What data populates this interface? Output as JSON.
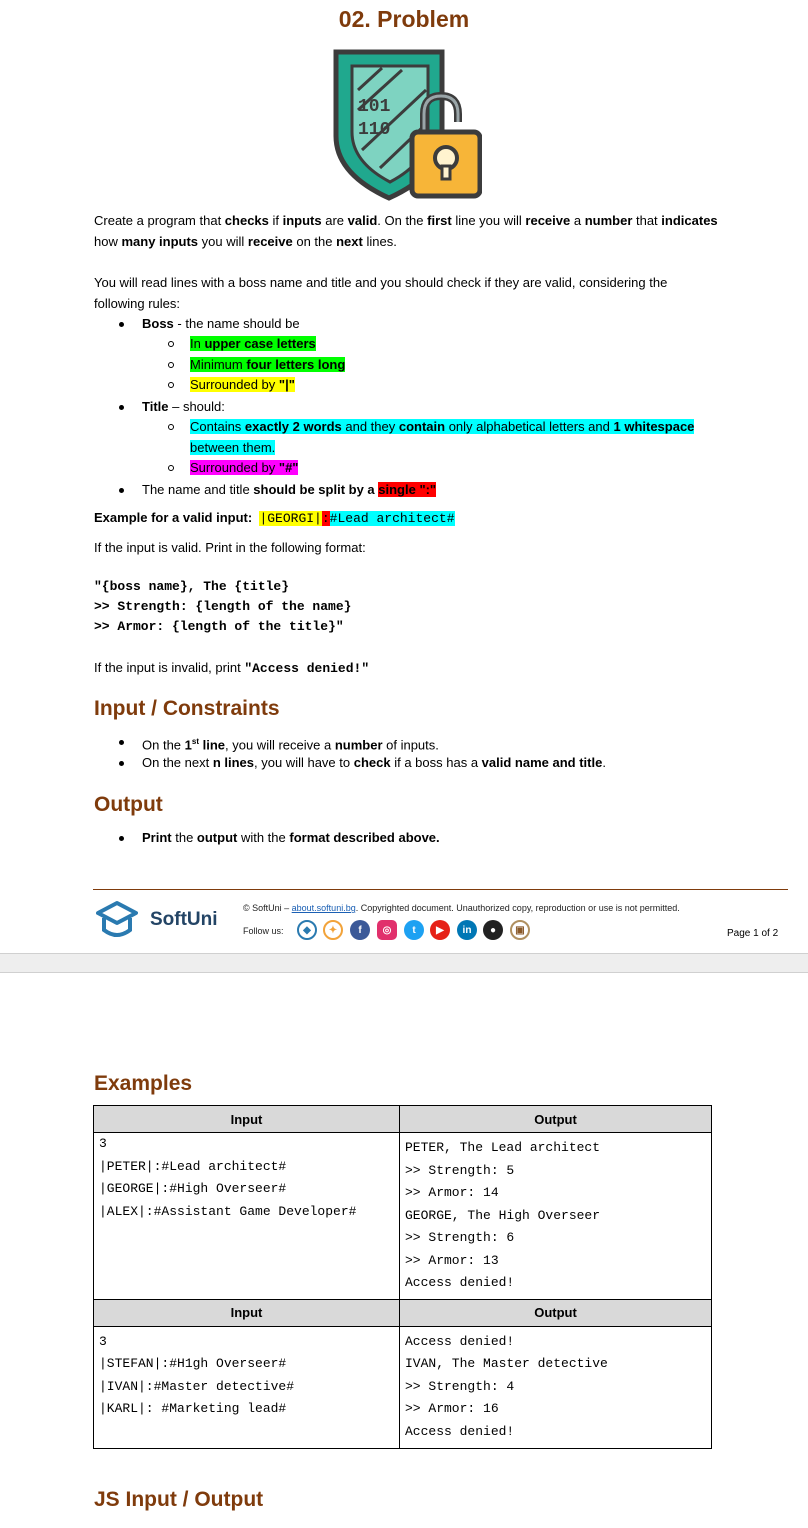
{
  "page1": {
    "title": "02. Problem",
    "intro": {
      "p1_a": "Create a program that ",
      "p1_b": "checks",
      "p1_c": " if ",
      "p1_d": "inputs",
      "p1_e": " are ",
      "p1_f": "valid",
      "p1_g": ". On the ",
      "p1_h": "first",
      "p1_i": " line you will ",
      "p1_j": "receive",
      "p1_k": " a ",
      "p1_l": "number",
      "p1_m": " that ",
      "p1_n": "indicates",
      "p1_o": " how ",
      "p1_p": "many inputs",
      "p1_q": " you will ",
      "p1_r": "receive",
      "p1_s": " on the ",
      "p1_t": "next",
      "p1_u": " lines.",
      "p2": "You will read lines with a boss name and title and you should check if they are valid, considering the following rules:"
    },
    "rules": {
      "boss_label": "Boss",
      "boss_text": " - the name should be",
      "boss_1a": "In ",
      "boss_1b": "upper case letters",
      "boss_2a": "Minimum ",
      "boss_2b": "four letters long",
      "boss_3a": "Surrounded by ",
      "boss_3b": "\"|\"",
      "title_label": "Title",
      "title_text": " – should:",
      "title_1a": "Contains ",
      "title_1b": "exactly 2 words",
      "title_1c": " and they ",
      "title_1d": "contain",
      "title_1e": " only alphabetical letters and ",
      "title_1f": "1 whitespace",
      "title_1g": "between them.",
      "title_2a": "Surrounded by ",
      "title_2b": "\"#\"",
      "split_a": "The name and title ",
      "split_b": "should be split by a ",
      "split_c": "single \":\""
    },
    "example": {
      "label": "Example for a valid input:",
      "part1": "|GEORGI|",
      "part2": ":",
      "part3": "#Lead architect#"
    },
    "valid_text": "If the input is valid. Print in the following format:",
    "format_lines": [
      "\"{boss name}, The {title}",
      ">> Strength: {length of the name}",
      ">> Armor: {length of the title}\""
    ],
    "invalid_a": "If the input is invalid, print ",
    "invalid_b": "\"Access denied!\"",
    "input_heading": "Input / Constraints",
    "input_1a": "On the ",
    "input_1b": "1",
    "input_1sup": "st",
    "input_1c": " line",
    "input_1d": ", you will receive a ",
    "input_1e": "number",
    "input_1f": " of inputs.",
    "input_2a": "On the next ",
    "input_2b": "n lines",
    "input_2c": ", you will have to ",
    "input_2d": "check",
    "input_2e": " if a boss has a ",
    "input_2f": "valid name and title",
    "input_2g": ".",
    "output_heading": "Output",
    "output_1a": "Print",
    "output_1b": " the ",
    "output_1c": "output",
    "output_1d": " with the ",
    "output_1e": "format described above.",
    "footer": {
      "brand": "SoftUni",
      "copy_a": "© SoftUni – ",
      "copy_link": "about.softuni.bg",
      "copy_b": ". Copyrighted document. Unauthorized copy, reproduction or use is not permitted.",
      "follow": "Follow us:",
      "page": "Page 1 of 2"
    }
  },
  "page2": {
    "examples_heading": "Examples",
    "table": [
      {
        "input_header": "Input",
        "output_header": "Output",
        "input": "3\n|PETER|:#Lead architect#\n|GEORGE|:#High Overseer#\n|ALEX|:#Assistant Game Developer#",
        "output": "PETER, The Lead architect\n>> Strength: 5\n>> Armor: 14\nGEORGE, The High Overseer\n>> Strength: 6\n>> Armor: 13\nAccess denied!"
      },
      {
        "input_header": "Input",
        "output_header": "Output",
        "input": "3\n|STEFAN|:#H1gh Overseer#\n|IVAN|:#Master detective#\n|KARL|: #Marketing lead#",
        "output": "Access denied!\nIVAN, The Master detective\n>> Strength: 4\n>> Armor: 16\nAccess denied!"
      }
    ],
    "js_heading": "JS Input / Output"
  },
  "colors": {
    "heading": "#7f3b0c",
    "highlight_green": "#00ff00",
    "highlight_yellow": "#ffff00",
    "highlight_cyan": "#00ffff",
    "highlight_magenta": "#ff00ff",
    "highlight_red": "#ff0000"
  }
}
